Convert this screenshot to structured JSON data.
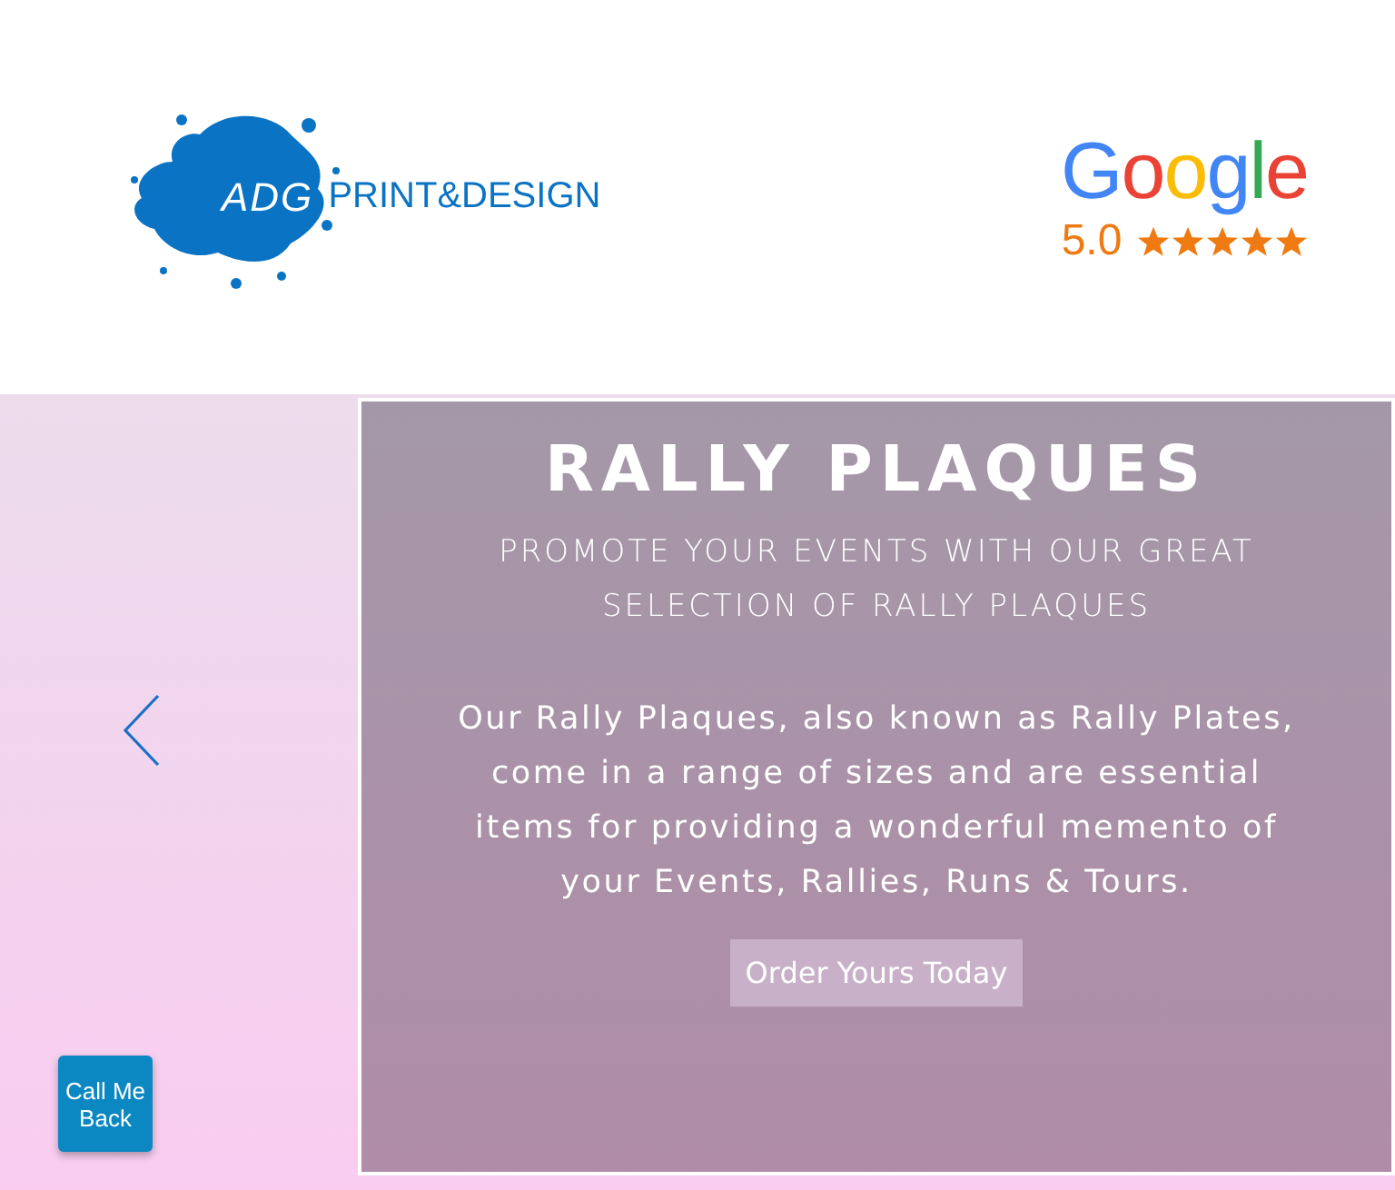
{
  "logo": {
    "initials": "ADG",
    "name": "PRINT&DESIGN"
  },
  "rating": {
    "brand": "Google",
    "score": "5.0",
    "stars": 5
  },
  "hero": {
    "title": "RALLY PLAQUES",
    "subtitle": "PROMOTE YOUR EVENTS WITH OUR GREAT SELECTION OF RALLY PLAQUES",
    "body": "Our Rally Plaques, also known as Rally Plates, come in a range of sizes and are essential items for providing a wonderful memento of your Events, Rallies, Runs & Tours.",
    "button": "Order Yours Today"
  },
  "callback": {
    "label": "Call Me Back"
  }
}
